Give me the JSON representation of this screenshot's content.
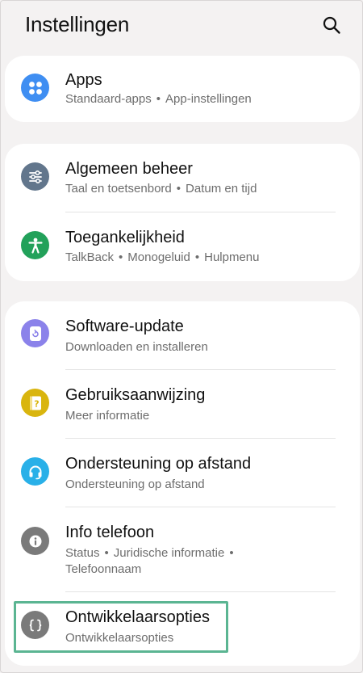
{
  "header": {
    "title": "Instellingen",
    "search_icon": "search-icon"
  },
  "colors": {
    "apps": "#3f8ef2",
    "general": "#62768c",
    "accessibility": "#22a15a",
    "software_update": "#8b82ea",
    "manual": "#d9b50e",
    "remote_support": "#29b0e8",
    "about_phone": "#7a7a7a",
    "developer": "#7a7a7a",
    "highlight": "#5bb592"
  },
  "groups": [
    {
      "items": [
        {
          "title": "Apps",
          "subs": [
            "Standaard-apps",
            "App-instellingen"
          ],
          "icon": "apps-grid-icon"
        }
      ]
    },
    {
      "items": [
        {
          "title": "Algemeen beheer",
          "subs": [
            "Taal en toetsenbord",
            "Datum en tijd"
          ],
          "icon": "sliders-icon"
        },
        {
          "title": "Toegankelijkheid",
          "subs": [
            "TalkBack",
            "Monogeluid",
            "Hulpmenu"
          ],
          "icon": "accessibility-person-icon"
        }
      ]
    },
    {
      "items": [
        {
          "title": "Software-update",
          "subs": [
            "Downloaden en installeren"
          ],
          "icon": "software-update-icon"
        },
        {
          "title": "Gebruiksaanwijzing",
          "subs": [
            "Meer informatie"
          ],
          "icon": "user-manual-icon"
        },
        {
          "title": "Ondersteuning op afstand",
          "subs": [
            "Ondersteuning op afstand"
          ],
          "icon": "headset-icon"
        },
        {
          "title": "Info telefoon",
          "subs": [
            "Status",
            "Juridische informatie",
            "Telefoonnaam"
          ],
          "icon": "info-icon"
        },
        {
          "title": "Ontwikkelaarsopties",
          "subs": [
            "Ontwikkelaarsopties"
          ],
          "icon": "developer-braces-icon"
        }
      ]
    }
  ]
}
